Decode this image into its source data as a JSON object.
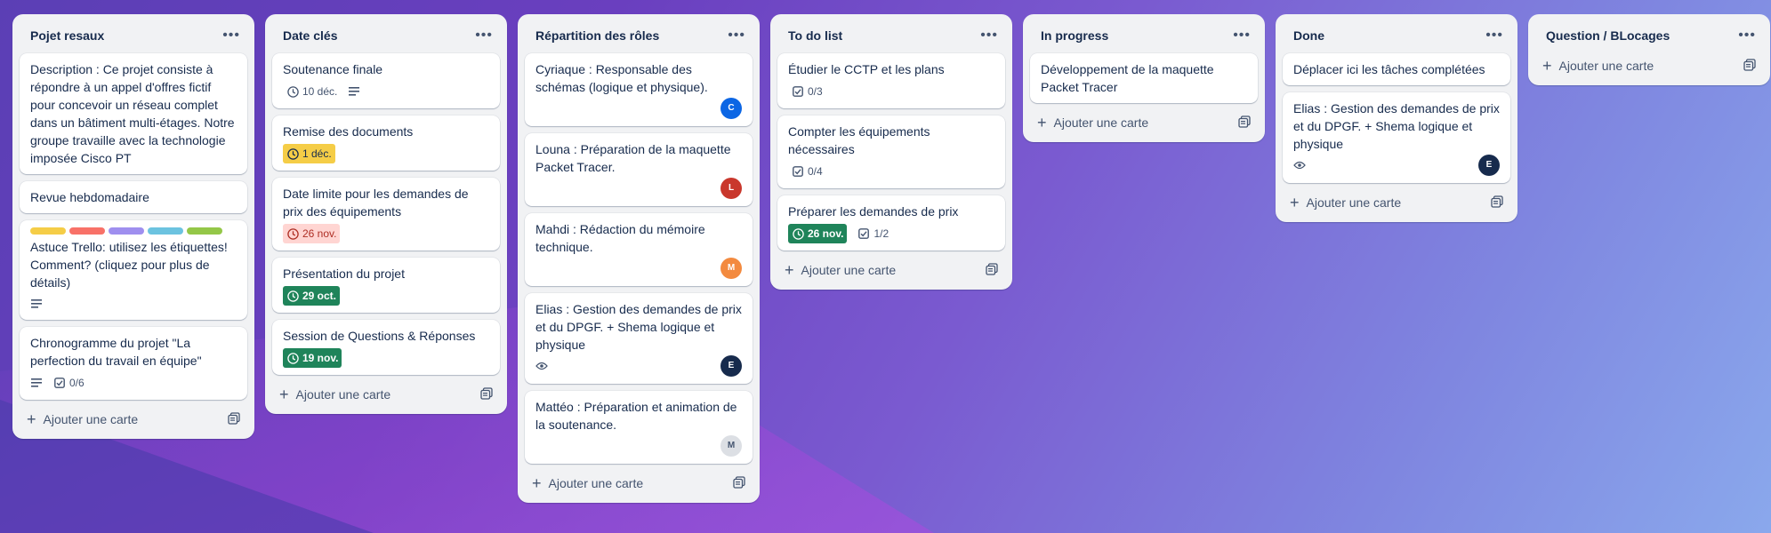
{
  "lists": [
    {
      "title": "Pojet resaux",
      "cards": [
        {
          "title": "Description : Ce projet consiste à répondre à un appel d'offres fictif pour concevoir un réseau complet dans un bâtiment multi-étages. Notre groupe travaille avec la technologie imposée Cisco PT"
        },
        {
          "title": "Revue hebdomadaire"
        },
        {
          "title": "Astuce Trello: utilisez les étiquettes! Comment? (cliquez pour plus de détails)"
        },
        {
          "title": "Chronogramme du projet \"La perfection du travail en équipe\"",
          "checklist": "0/6"
        }
      ],
      "add_label": "Ajouter une carte"
    },
    {
      "title": "Date clés",
      "cards": [
        {
          "title": "Soutenance finale",
          "due": "10 déc."
        },
        {
          "title": "Remise des documents",
          "due": "1 déc."
        },
        {
          "title": "Date limite pour les demandes de prix des équipements",
          "due": "26 nov."
        },
        {
          "title": "Présentation du projet",
          "due": "29 oct."
        },
        {
          "title": "Session de Questions & Réponses",
          "due": "19 nov."
        }
      ],
      "add_label": "Ajouter une carte"
    },
    {
      "title": "Répartition des rôles",
      "cards": [
        {
          "title": "Cyriaque : Responsable des schémas (logique et physique).",
          "avatar": "C"
        },
        {
          "title": "Louna : Préparation de la maquette Packet Tracer.",
          "avatar": "L"
        },
        {
          "title": "Mahdi : Rédaction du mémoire technique.",
          "avatar": "M"
        },
        {
          "title": "Elias : Gestion des demandes de prix et du DPGF. + Shema logique et physique",
          "avatar": "E"
        },
        {
          "title": "Mattéo : Préparation et animation de la soutenance.",
          "avatar": "M"
        }
      ],
      "add_label": "Ajouter une carte"
    },
    {
      "title": "To do list",
      "cards": [
        {
          "title": "Étudier le CCTP et les plans",
          "checklist": "0/3"
        },
        {
          "title": "Compter les équipements nécessaires",
          "checklist": "0/4"
        },
        {
          "title": "Préparer les demandes de prix",
          "due": "26 nov.",
          "checklist": "1/2"
        }
      ],
      "add_label": "Ajouter une carte"
    },
    {
      "title": "In progress",
      "cards": [
        {
          "title": "Développement de la maquette Packet Tracer"
        }
      ],
      "add_label": "Ajouter une carte"
    },
    {
      "title": "Done",
      "cards": [
        {
          "title": "Déplacer ici les tâches complétées"
        },
        {
          "title": "Elias : Gestion des demandes de prix et du DPGF. + Shema logique et physique",
          "avatar": "E"
        }
      ],
      "add_label": "Ajouter une carte"
    },
    {
      "title": "Question / BLocages",
      "cards": [],
      "add_label": "Ajouter une carte"
    }
  ],
  "colors": {
    "label_yellow": "#f5cd47",
    "label_red": "#f87168",
    "label_purple": "#9f8fef",
    "label_blue": "#6cc3e0",
    "label_green": "#94c748",
    "avatar_blue": "#0c66e4",
    "avatar_red": "#c9372c",
    "avatar_orange": "#f38a3f",
    "avatar_navy": "#172b4d",
    "avatar_gray": "#dcdfe4"
  }
}
